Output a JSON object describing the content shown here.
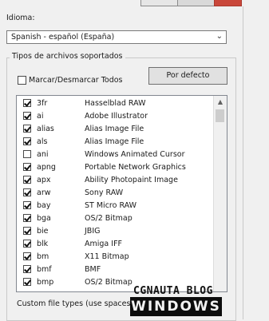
{
  "language": {
    "label": "Idioma:",
    "selected": "Spanish - español (España)"
  },
  "file_types": {
    "group_title": "Tipos de archivos soportados",
    "toggle_all_label": "Marcar/Desmarcar Todos",
    "default_button": "Por defecto",
    "items": [
      {
        "ext": "3fr",
        "desc": "Hasselblad RAW",
        "checked": true
      },
      {
        "ext": "ai",
        "desc": "Adobe Illustrator",
        "checked": true
      },
      {
        "ext": "alias",
        "desc": "Alias Image File",
        "checked": true
      },
      {
        "ext": "als",
        "desc": "Alias Image File",
        "checked": true
      },
      {
        "ext": "ani",
        "desc": "Windows Animated Cursor",
        "checked": false
      },
      {
        "ext": "apng",
        "desc": "Portable Network Graphics",
        "checked": true
      },
      {
        "ext": "apx",
        "desc": "Ability Photopaint Image",
        "checked": true
      },
      {
        "ext": "arw",
        "desc": "Sony RAW",
        "checked": true
      },
      {
        "ext": "bay",
        "desc": "ST Micro RAW",
        "checked": true
      },
      {
        "ext": "bga",
        "desc": "OS/2 Bitmap",
        "checked": true
      },
      {
        "ext": "bie",
        "desc": "JBIG",
        "checked": true
      },
      {
        "ext": "blk",
        "desc": "Amiga IFF",
        "checked": true
      },
      {
        "ext": "bm",
        "desc": "X11 Bitmap",
        "checked": true
      },
      {
        "ext": "bmf",
        "desc": "BMF",
        "checked": true
      },
      {
        "ext": "bmp",
        "desc": "OS/2 Bitmap",
        "checked": true
      }
    ],
    "custom_label": "Custom file types (use spaces"
  },
  "watermark": {
    "line1": "CGNAUTA BLOG",
    "line2": "WINDOWS"
  },
  "colors": {
    "close_button": "#c9473a",
    "background": "#f0f0f0"
  }
}
